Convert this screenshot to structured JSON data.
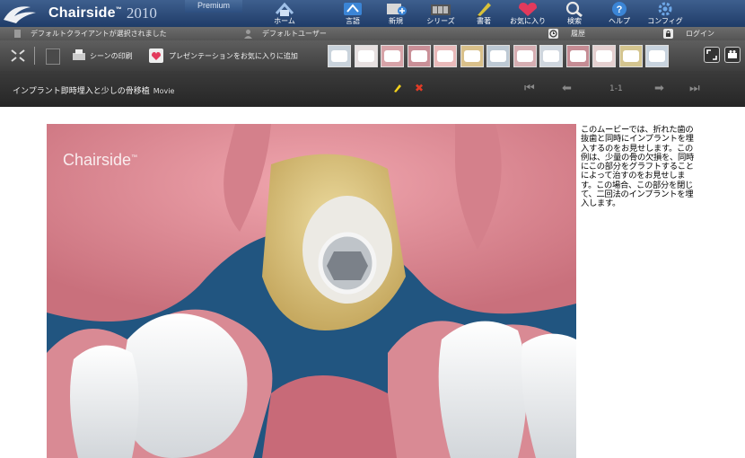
{
  "header": {
    "brand": "Chairside",
    "brand_mark": "™",
    "year": "2010",
    "edition": "Premium",
    "nav": [
      {
        "label": "ホーム",
        "icon": "home-icon"
      },
      {
        "label": "言語",
        "icon": "language-icon"
      },
      {
        "label": "新規",
        "icon": "new-icon"
      },
      {
        "label": "シリーズ",
        "icon": "series-icon"
      },
      {
        "label": "書著",
        "icon": "author-icon"
      },
      {
        "label": "お気に入り",
        "icon": "favorites-icon"
      },
      {
        "label": "検索",
        "icon": "search-icon"
      },
      {
        "label": "ヘルプ",
        "icon": "help-icon"
      },
      {
        "label": "コンフィグ",
        "icon": "config-icon"
      }
    ]
  },
  "status": {
    "client": "デフォルトクライアントが選択されました",
    "user": "デフォルトユーザー",
    "history": "履歴",
    "login": "ログイン"
  },
  "toolbar": {
    "print_scene": "シーンの印刷",
    "add_favorite": "プレゼンテーションをお気に入りに追加"
  },
  "title_bar": {
    "title": "インプラント即時埋入と少しの骨移植",
    "type": "Movie",
    "page": "1-1"
  },
  "movie": {
    "watermark": "Chairside",
    "watermark_mark": "™"
  },
  "description": "このムービーでは、折れた歯の抜歯と同時にインプラントを埋入するのをお見せします。この例は、少量の骨の欠損を、同時にこの部分をグラフトすることによって治すのをお見せします。この場合、この部分を閉じて、二回法のインプラントを埋入します。",
  "colors": {
    "header": "#2a4a78",
    "toolbar": "#4a4a4a",
    "titlebar": "#2e2e2e",
    "gum": "#d9838e",
    "bone": "#d9c68a"
  }
}
